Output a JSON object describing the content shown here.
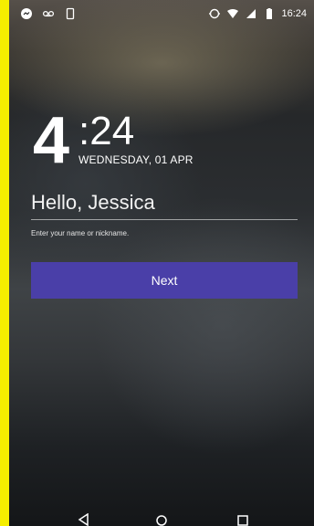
{
  "status_bar": {
    "time": "16:24",
    "left_icons": [
      "messenger-icon",
      "voicemail-icon",
      "phone-icon"
    ],
    "right_icons": [
      "sync-icon",
      "wifi-icon",
      "signal-icon",
      "battery-icon"
    ]
  },
  "clock": {
    "hour": "4",
    "minutes": ":24",
    "date": "WEDNESDAY, 01 APR"
  },
  "form": {
    "name_value": "Hello, Jessica",
    "helper_text": "Enter your name or nickname.",
    "next_label": "Next"
  },
  "navigation_bar": {
    "buttons": [
      "back-icon",
      "home-icon",
      "recents-icon"
    ]
  },
  "colors": {
    "frame": "#f5ee00",
    "button": "#4a3fa8",
    "text": "#ffffff"
  }
}
